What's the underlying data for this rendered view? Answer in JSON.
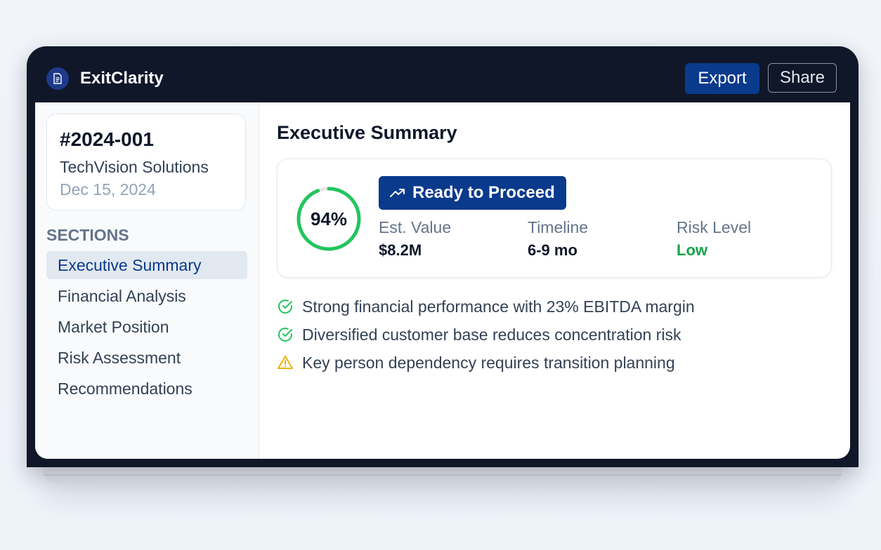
{
  "app": {
    "name": "ExitClarity",
    "export_label": "Export",
    "share_label": "Share"
  },
  "sidebar": {
    "deal": {
      "id": "#2024-001",
      "company": "TechVision Solutions",
      "date": "Dec 15, 2024"
    },
    "sections_title": "SECTIONS",
    "items": [
      {
        "label": "Executive Summary",
        "active": true
      },
      {
        "label": "Financial Analysis",
        "active": false
      },
      {
        "label": "Market Position",
        "active": false
      },
      {
        "label": "Risk Assessment",
        "active": false
      },
      {
        "label": "Recommendations",
        "active": false
      }
    ]
  },
  "main": {
    "title": "Executive Summary",
    "score": {
      "value": 94,
      "label": "94%"
    },
    "status": "Ready to Proceed",
    "metrics": [
      {
        "label": "Est. Value",
        "value": "$8.2M"
      },
      {
        "label": "Timeline",
        "value": "6-9 mo"
      },
      {
        "label": "Risk Level",
        "value": "Low"
      }
    ],
    "findings": [
      {
        "icon": "check-circle-icon",
        "text": "Strong financial performance with 23% EBITDA margin"
      },
      {
        "icon": "check-circle-icon",
        "text": "Diversified customer base reduces concentration risk"
      },
      {
        "icon": "warning-triangle-icon",
        "text": "Key person dependency requires transition planning"
      }
    ]
  },
  "colors": {
    "navy": "#0f1729",
    "brand": "#0a3a8c",
    "success": "#22c55e",
    "success_text": "#16a34a",
    "warning": "#eab308"
  }
}
